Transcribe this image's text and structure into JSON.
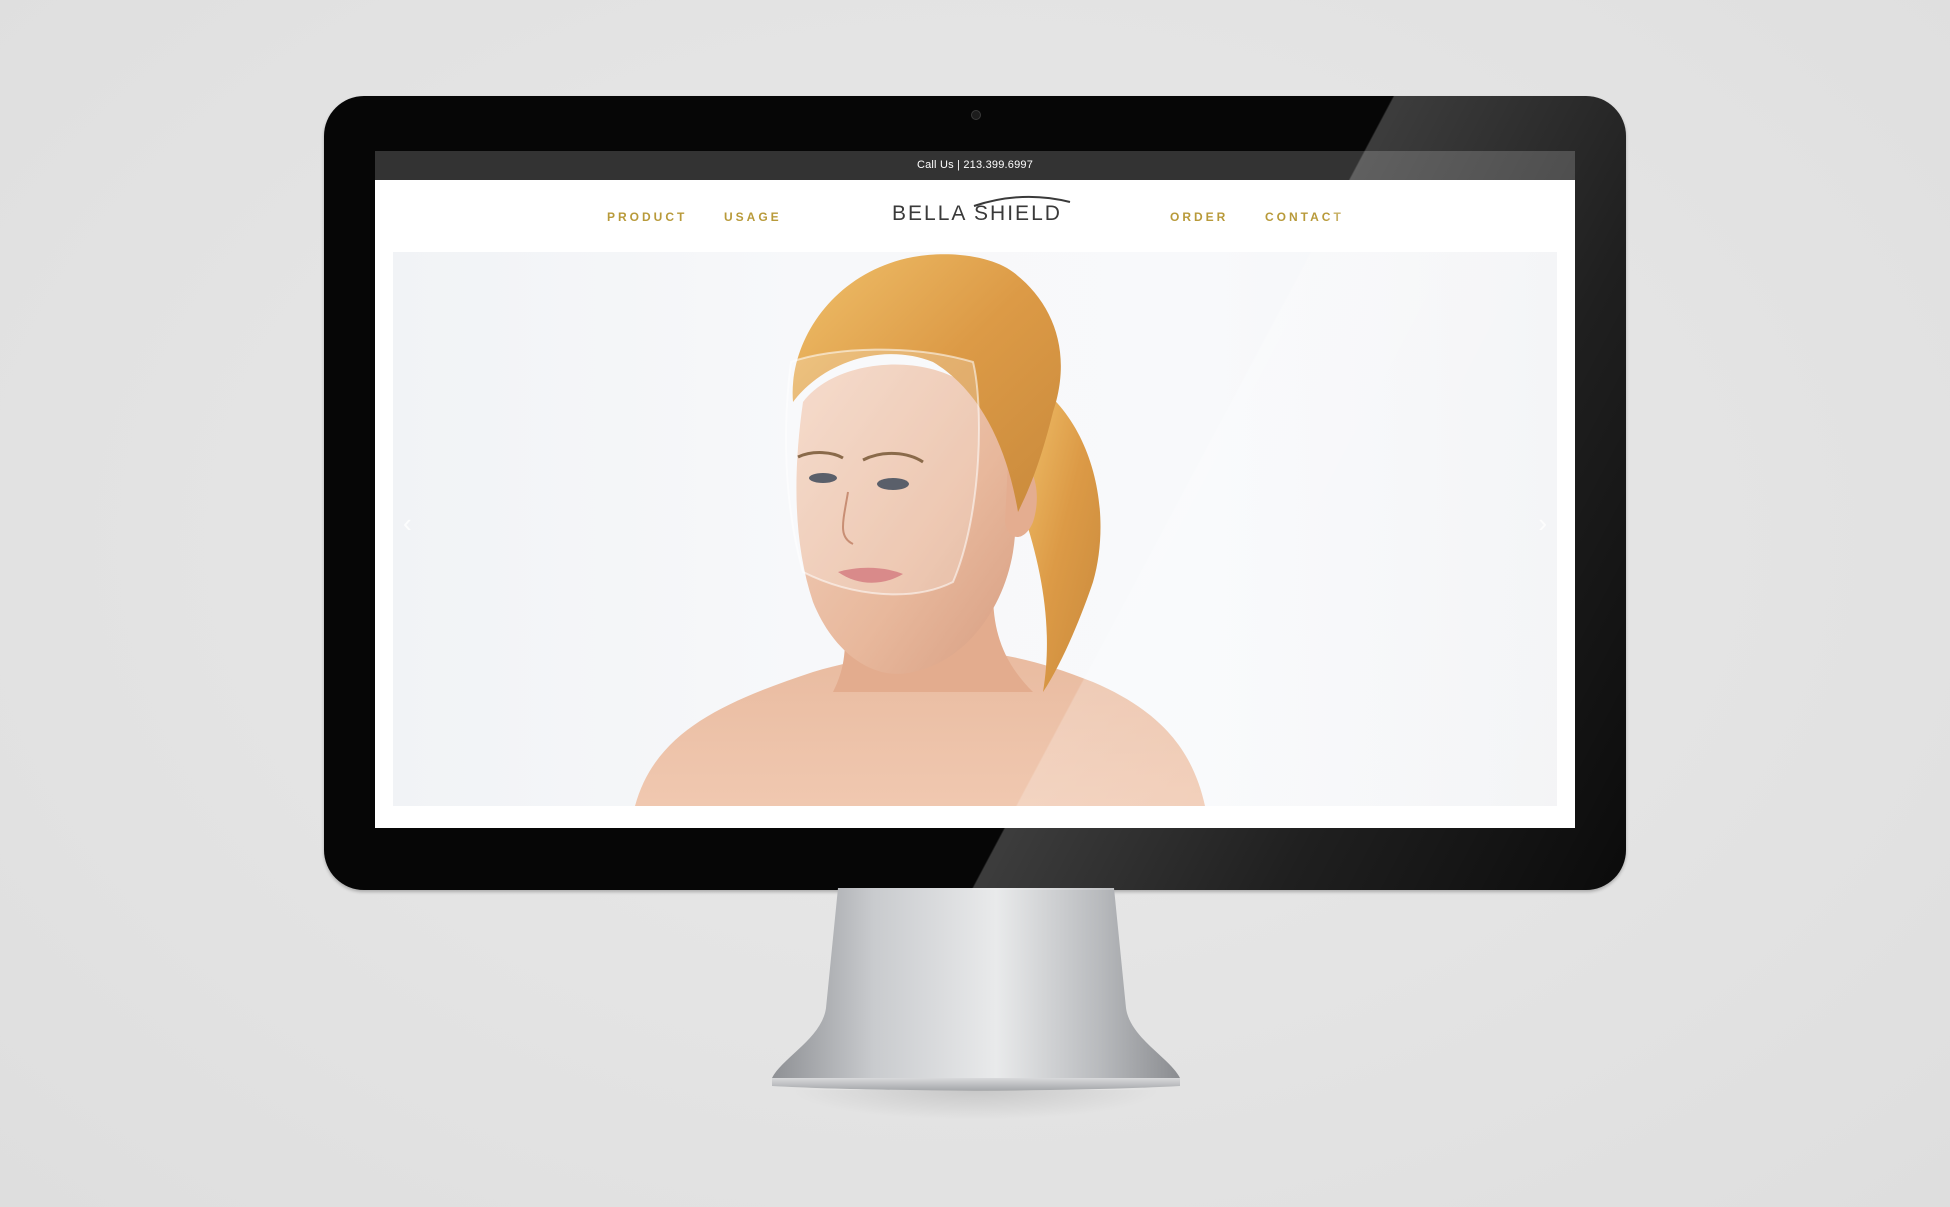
{
  "topbar": {
    "call_text": "Call Us | 213.399.6997"
  },
  "nav": {
    "left": [
      "PRODUCT",
      "USAGE"
    ],
    "right": [
      "ORDER",
      "CONTACT"
    ],
    "logo_text": "BELLA SHIELD"
  },
  "hero": {
    "prev_arrow": "‹",
    "next_arrow": "›"
  },
  "colors": {
    "nav_gold": "#b89a3a",
    "topbar_bg": "#333333",
    "bezel": "#060606"
  }
}
